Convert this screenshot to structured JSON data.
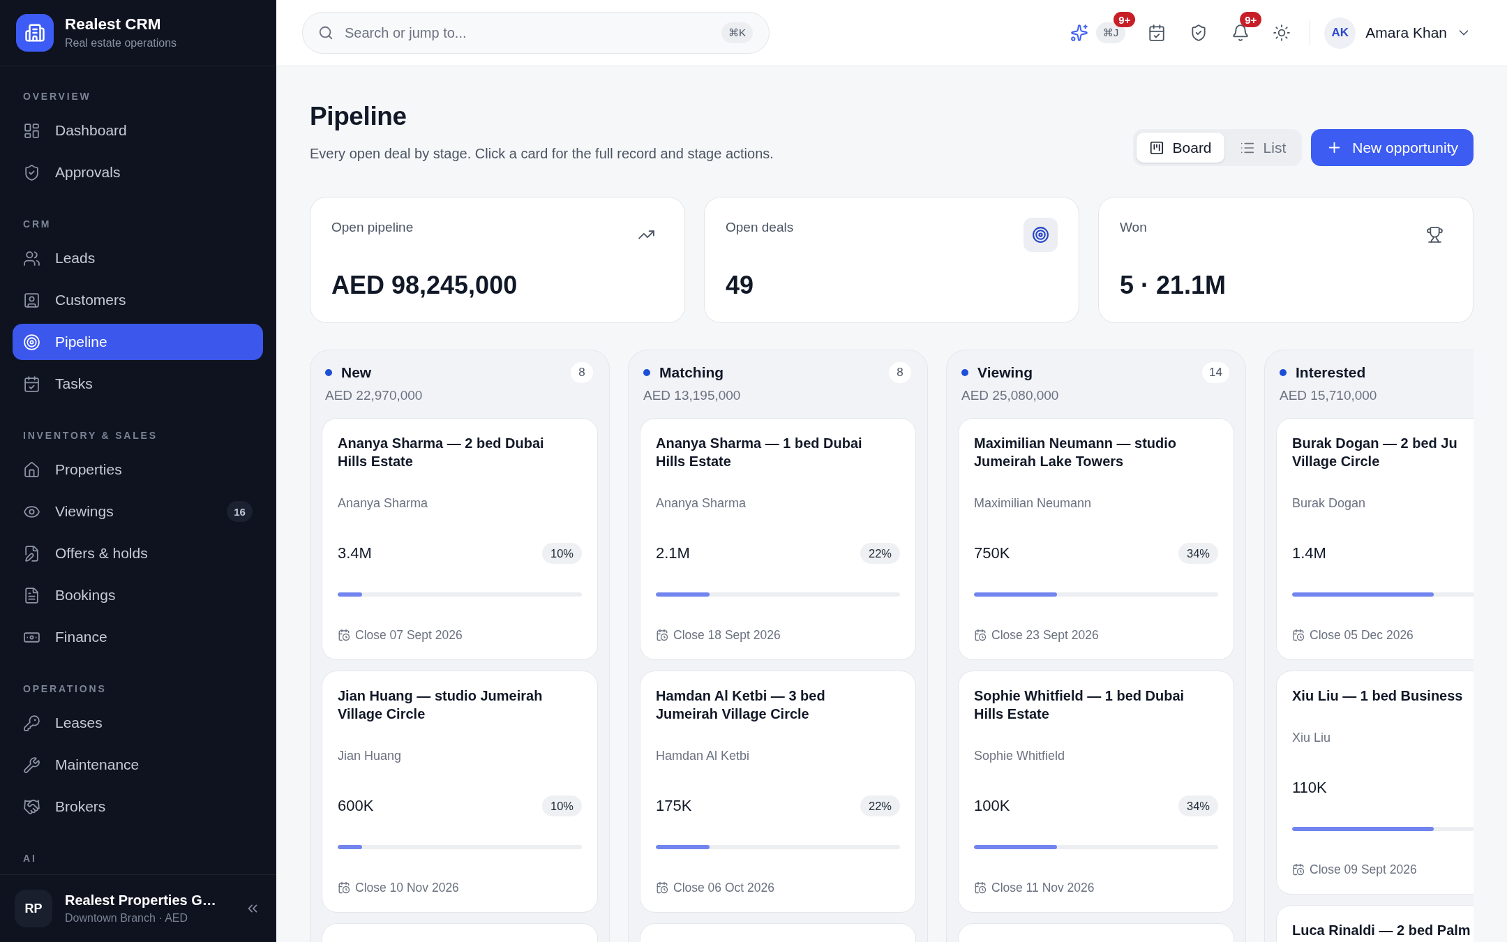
{
  "sidebar": {
    "brand": {
      "title": "Realest CRM",
      "subtitle": "Real estate operations"
    },
    "sections": [
      {
        "label": "OVERVIEW",
        "items": [
          {
            "label": "Dashboard",
            "selected": false
          },
          {
            "label": "Approvals",
            "selected": false
          }
        ]
      },
      {
        "label": "CRM",
        "items": [
          {
            "label": "Leads",
            "selected": false
          },
          {
            "label": "Customers",
            "selected": false
          },
          {
            "label": "Pipeline",
            "selected": true
          },
          {
            "label": "Tasks",
            "selected": false
          }
        ]
      },
      {
        "label": "INVENTORY & SALES",
        "items": [
          {
            "label": "Properties",
            "selected": false
          },
          {
            "label": "Viewings",
            "selected": false,
            "badge": "16"
          },
          {
            "label": "Offers & holds",
            "selected": false
          },
          {
            "label": "Bookings",
            "selected": false
          },
          {
            "label": "Finance",
            "selected": false
          }
        ]
      },
      {
        "label": "OPERATIONS",
        "items": [
          {
            "label": "Leases",
            "selected": false
          },
          {
            "label": "Maintenance",
            "selected": false
          },
          {
            "label": "Brokers",
            "selected": false
          }
        ]
      },
      {
        "label": "AI"
      }
    ],
    "workspace": {
      "initials": "RP",
      "name": "Realest Properties G…",
      "detail": "Downtown Branch · AED"
    }
  },
  "topbar": {
    "search": {
      "placeholder": "Search or jump to...",
      "shortcut": "⌘K"
    },
    "assistant": {
      "shortcut": "⌘J",
      "badge": "9+"
    },
    "notifications": {
      "badge": "9+"
    },
    "user": {
      "initials": "AK",
      "name": "Amara Khan"
    }
  },
  "page": {
    "title": "Pipeline",
    "subtitle": "Every open deal by stage. Click a card for the full record and stage actions.",
    "view_toggle": [
      {
        "label": "Board",
        "selected": true
      },
      {
        "label": "List",
        "selected": false
      }
    ],
    "primary_action": "New opportunity"
  },
  "stats": [
    {
      "label": "Open pipeline",
      "value": "AED 98,245,000"
    },
    {
      "label": "Open deals",
      "value": "49"
    },
    {
      "label": "Won",
      "value": "5 · 21.1M"
    }
  ],
  "board": {
    "columns": [
      {
        "name": "New",
        "count": "8",
        "total": "AED 22,970,000",
        "cards": [
          {
            "kind": "deal",
            "title": "Ananya Sharma — 2 bed Dubai Hills Estate",
            "contact": "Ananya Sharma",
            "value": "3.4M",
            "probability": "10%",
            "level": 0.1,
            "close": "Close 07 Sept 2026"
          },
          {
            "kind": "deal",
            "title": "Jian Huang — studio Jumeirah Village Circle",
            "contact": "Jian Huang",
            "value": "600K",
            "probability": "10%",
            "level": 0.1,
            "close": "Close 10 Nov 2026"
          },
          {
            "kind": "stub"
          }
        ]
      },
      {
        "name": "Matching",
        "count": "8",
        "total": "AED 13,195,000",
        "cards": [
          {
            "kind": "deal",
            "title": "Ananya Sharma — 1 bed Dubai Hills Estate",
            "contact": "Ananya Sharma",
            "value": "2.1M",
            "probability": "22%",
            "level": 0.22,
            "close": "Close 18 Sept 2026"
          },
          {
            "kind": "deal",
            "title": "Hamdan Al Ketbi — 3 bed Jumeirah Village Circle",
            "contact": "Hamdan Al Ketbi",
            "value": "175K",
            "probability": "22%",
            "level": 0.22,
            "close": "Close 06 Oct 2026"
          },
          {
            "kind": "stub"
          }
        ]
      },
      {
        "name": "Viewing",
        "count": "14",
        "total": "AED 25,080,000",
        "cards": [
          {
            "kind": "deal",
            "title": "Maximilian Neumann — studio Jumeirah Lake Towers",
            "contact": "Maximilian Neumann",
            "value": "750K",
            "probability": "34%",
            "level": 0.34,
            "close": "Close 23 Sept 2026"
          },
          {
            "kind": "deal",
            "title": "Sophie Whitfield — 1 bed Dubai Hills Estate",
            "contact": "Sophie Whitfield",
            "value": "100K",
            "probability": "34%",
            "level": 0.34,
            "close": "Close 11 Nov 2026"
          },
          {
            "kind": "stub"
          }
        ]
      },
      {
        "name": "Interested",
        "total": "AED 15,710,000",
        "cards": [
          {
            "kind": "deal",
            "title": "Burak Dogan — 2 bed Ju\nVillage Circle",
            "contact": "Burak Dogan",
            "value": "1.4M",
            "level": 0.58,
            "close": "Close 05 Dec 2026"
          },
          {
            "kind": "deal",
            "title": "Xiu Liu — 1 bed Business",
            "contact": "Xiu Liu",
            "value": "110K",
            "level": 0.58,
            "close": "Close 09 Sept 2026"
          },
          {
            "kind": "deal",
            "title": "Luca Rinaldi — 2 bed Palm"
          }
        ]
      }
    ]
  }
}
